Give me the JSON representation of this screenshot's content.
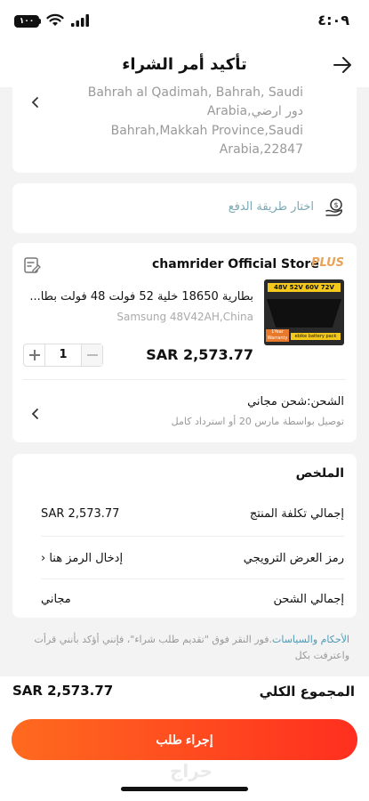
{
  "status_bar": {
    "time": "٤:٠٩",
    "battery": "١٠٠"
  },
  "header": {
    "title": "تأكيد أمر الشراء"
  },
  "address": {
    "line1": "Bahrah al Qadimah, Bahrah, Saudi",
    "line2": "Arabia,دور ارضي",
    "line3": "Bahrah,Makkah Province,Saudi",
    "line4": "Arabia,22847"
  },
  "payment": {
    "label": "اختار طريقة الدفع"
  },
  "store": {
    "badge": "PLUS",
    "name": "chamrider Official Store",
    "product": {
      "title": "بطارية 18650 خلية 52 فولت 48 فولت بطا...",
      "variant": "Samsung 48V42AH,China",
      "price": "SAR 2,573.77",
      "quantity": "1",
      "thumb_label": "48V 52V 60V 72V",
      "thumb_warranty": "1Year Warranty",
      "thumb_footer": "ebike battery pack"
    },
    "shipping_title": "الشحن:شحن مجاني",
    "shipping_sub": "توصيل بواسطة مارس 20 أو استرداد كامل"
  },
  "summary": {
    "title": "الملخص",
    "rows": [
      {
        "label": "إجمالي تكلفة المنتج",
        "value": "SAR 2,573.77"
      },
      {
        "label": "رمز العرض الترويجي",
        "value": "إدخال الرمز هنا"
      },
      {
        "label": "إجمالي الشحن",
        "value": "مجاني"
      }
    ]
  },
  "terms": {
    "link": "الأحكام والسياسات",
    "text": ".فور النقر فوق \"تقديم طلب شراء\"، فإنني أؤكد بأنني قرأت واعترفت بكل"
  },
  "footer": {
    "total_label": "المجموع الكلي",
    "total_value": "SAR 2,573.77",
    "button_label": "إجراء طلب",
    "watermark": "حراج"
  }
}
